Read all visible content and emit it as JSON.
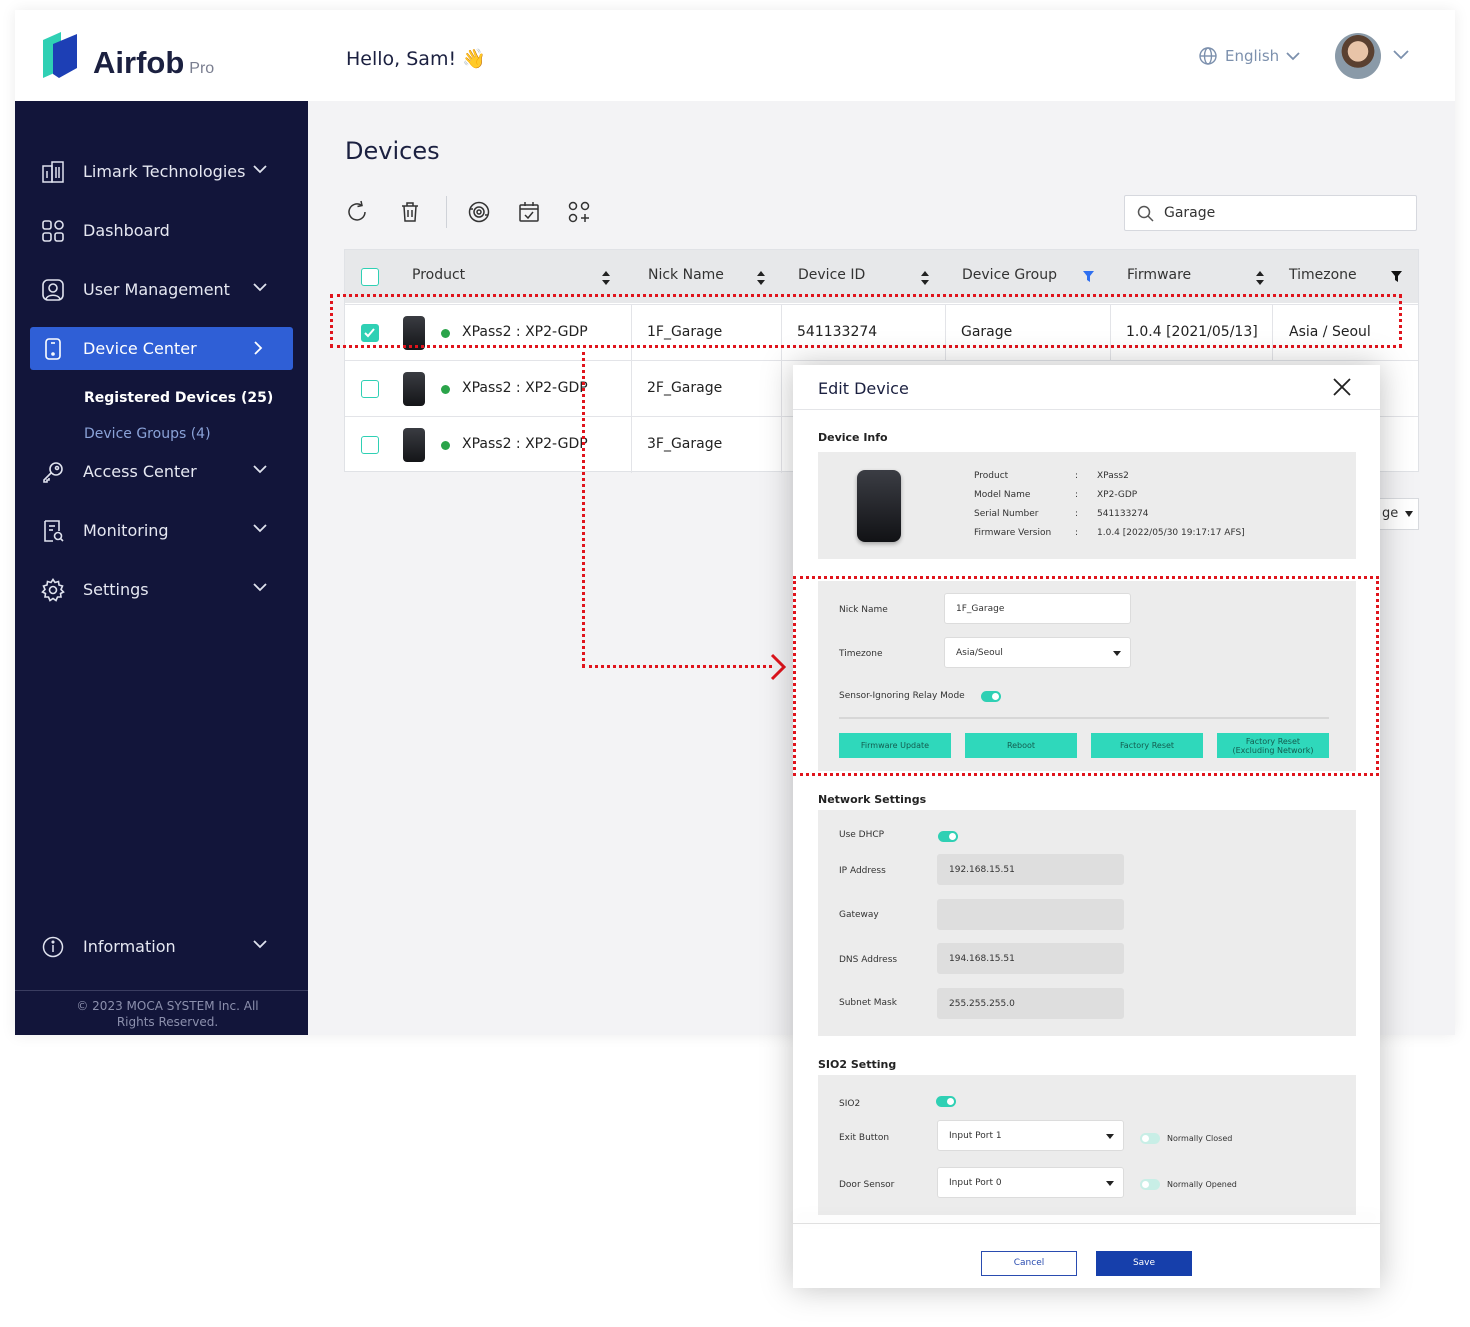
{
  "brand": {
    "name": "Airfob",
    "tier": "Pro"
  },
  "header": {
    "greeting": "Hello, Sam! 👋",
    "language": "English"
  },
  "sidebar": {
    "items": [
      {
        "label": "Limark Technologies"
      },
      {
        "label": "Dashboard"
      },
      {
        "label": "User Management"
      },
      {
        "label": "Device Center"
      },
      {
        "label": "Access Center"
      },
      {
        "label": "Monitoring"
      },
      {
        "label": "Settings"
      },
      {
        "label": "Information"
      }
    ],
    "sub_items": [
      {
        "label": "Registered Devices (25)"
      },
      {
        "label": "Device Groups  (4)"
      }
    ],
    "copyright_line1": "© 2023 MOCA SYSTEM Inc. All",
    "copyright_line2": "Rights Reserved."
  },
  "page": {
    "title": "Devices",
    "search_value": "Garage",
    "pager_text": "ge"
  },
  "table": {
    "columns": [
      "Product",
      "Nick Name",
      "Device ID",
      "Device Group",
      "Firmware",
      "Timezone"
    ],
    "rows": [
      {
        "product": "XPass2 : XP2-GDP",
        "nick": "1F_Garage",
        "id": "541133274",
        "group": "Garage",
        "firmware": "1.0.4 [2021/05/13]",
        "tz": "Asia / Seoul",
        "checked": true
      },
      {
        "product": "XPass2 : XP2-GDP",
        "nick": "2F_Garage",
        "checked": false
      },
      {
        "product": "XPass2 : XP2-GDP",
        "nick": "3F_Garage",
        "checked": false
      }
    ]
  },
  "modal": {
    "title": "Edit Device",
    "device_info_title": "Device Info",
    "info": [
      {
        "k": "Product",
        "v": "XPass2"
      },
      {
        "k": "Model Name",
        "v": "XP2-GDP"
      },
      {
        "k": "Serial Number",
        "v": "541133274"
      },
      {
        "k": "Firmware Version",
        "v": "1.0.4 [2022/05/30 19:17:17 AFS]"
      }
    ],
    "colon": ":",
    "nick_label": "Nick Name",
    "nick_value": "1F_Garage",
    "tz_label": "Timezone",
    "tz_value": "Asia/Seoul",
    "relay_label": "Sensor-Ignoring Relay Mode",
    "buttons": [
      "Firmware Update",
      "Reboot",
      "Factory Reset",
      "Factory Reset\n(Excluding Network)"
    ],
    "network_title": "Network Settings",
    "dhcp_label": "Use DHCP",
    "ip_label": "IP Address",
    "ip_value": "192.168.15.51",
    "gw_label": "Gateway",
    "gw_value": "",
    "dns_label": "DNS Address",
    "dns_value": "194.168.15.51",
    "subnet_label": "Subnet Mask",
    "subnet_value": "255.255.255.0",
    "sio_title": "SIO2 Setting",
    "sio_label": "SIO2",
    "exit_label": "Exit Button",
    "exit_value": "Input  Port 1",
    "exit_mode": "Normally Closed",
    "door_label": "Door Sensor",
    "door_value": "Input Port 0",
    "door_mode": "Normally Opened",
    "cancel": "Cancel",
    "save": "Save"
  },
  "colors": {
    "sidebar": "#12153a",
    "accent": "#2f5fd6",
    "teal": "#2fd0b4",
    "highlight": "#e0141c"
  }
}
